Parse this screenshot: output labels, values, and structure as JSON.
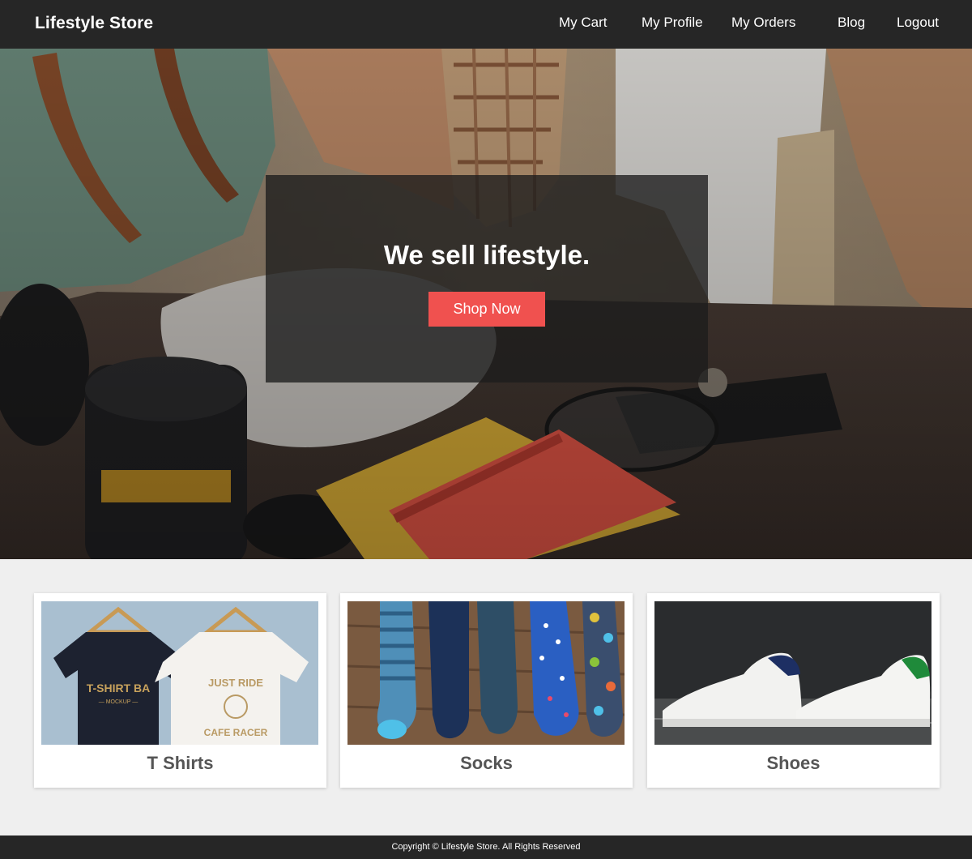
{
  "navbar": {
    "brand": "Lifestyle Store",
    "links": [
      "My Cart",
      "My Profile",
      "My Orders",
      "Blog",
      "Logout"
    ]
  },
  "hero": {
    "title": "We sell lifestyle.",
    "button_label": "Shop Now",
    "button_color": "#f0514f"
  },
  "categories": [
    {
      "label": "T Shirts",
      "image": "t-shirts-photo"
    },
    {
      "label": "Socks",
      "image": "socks-photo"
    },
    {
      "label": "Shoes",
      "image": "shoes-photo"
    }
  ],
  "footer": {
    "copyright": "Copyright © Lifestyle Store. All Rights Reserved"
  }
}
